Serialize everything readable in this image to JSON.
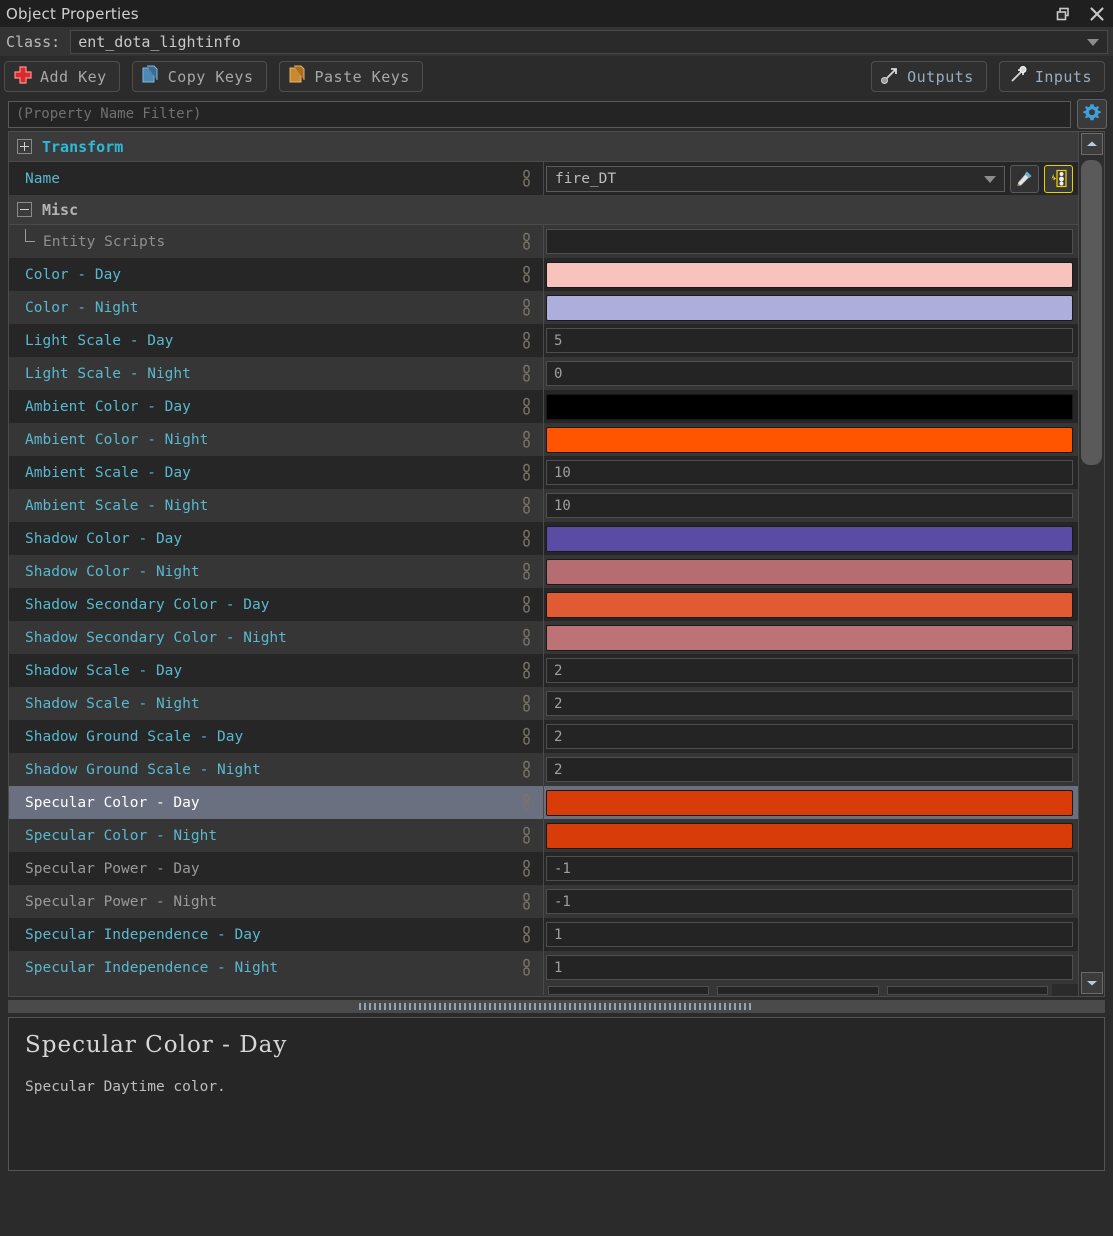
{
  "window": {
    "title": "Object Properties",
    "restore_icon": "restore-window-icon",
    "close_icon": "close-icon"
  },
  "class_row": {
    "label": "Class:",
    "value": "ent_dota_lightinfo",
    "dropdown_icon": "chevron-down-icon"
  },
  "toolbar": {
    "add_key": "Add Key",
    "copy_keys": "Copy Keys",
    "paste_keys": "Paste Keys",
    "outputs": "Outputs",
    "inputs": "Inputs"
  },
  "filter": {
    "placeholder": "(Property Name Filter)",
    "settings_icon": "gear-icon"
  },
  "categories": {
    "transform": "Transform",
    "misc": "Misc"
  },
  "name_row": {
    "label": "Name",
    "value": "fire_DT",
    "eyedropper_icon": "eyedropper-icon",
    "picker_icon": "entity-picker-icon"
  },
  "properties": [
    {
      "label": "Entity Scripts",
      "type": "text",
      "value": "",
      "style": "child"
    },
    {
      "label": "Color - Day",
      "type": "color",
      "value": "#f8c2bd"
    },
    {
      "label": "Color - Night",
      "type": "color",
      "value": "#aeaedd"
    },
    {
      "label": "Light Scale - Day",
      "type": "text",
      "value": "5"
    },
    {
      "label": "Light Scale - Night",
      "type": "text",
      "value": "0"
    },
    {
      "label": "Ambient Color - Day",
      "type": "color",
      "value": "#000000"
    },
    {
      "label": "Ambient Color - Night",
      "type": "color",
      "value": "#ff5500"
    },
    {
      "label": "Ambient Scale - Day",
      "type": "text",
      "value": "10"
    },
    {
      "label": "Ambient Scale - Night",
      "type": "text",
      "value": "10"
    },
    {
      "label": "Shadow Color - Day",
      "type": "color",
      "value": "#5a4ca5"
    },
    {
      "label": "Shadow Color - Night",
      "type": "color",
      "value": "#b56d71"
    },
    {
      "label": "Shadow Secondary Color - Day",
      "type": "color",
      "value": "#e05a34"
    },
    {
      "label": "Shadow Secondary Color - Night",
      "type": "color",
      "value": "#bd7376"
    },
    {
      "label": "Shadow Scale - Day",
      "type": "text",
      "value": "2"
    },
    {
      "label": "Shadow Scale - Night",
      "type": "text",
      "value": "2"
    },
    {
      "label": "Shadow Ground Scale - Day",
      "type": "text",
      "value": "2"
    },
    {
      "label": "Shadow Ground Scale - Night",
      "type": "text",
      "value": "2"
    },
    {
      "label": "Specular Color - Day",
      "type": "color",
      "value": "#d83c08",
      "selected": true
    },
    {
      "label": "Specular Color - Night",
      "type": "color",
      "value": "#d83c08"
    },
    {
      "label": "Specular Power - Day",
      "type": "text",
      "value": "-1",
      "style": "gray"
    },
    {
      "label": "Specular Power - Night",
      "type": "text",
      "value": "-1",
      "style": "gray"
    },
    {
      "label": "Specular Independence - Day",
      "type": "text",
      "value": "1"
    },
    {
      "label": "Specular Independence - Night",
      "type": "text",
      "value": "1"
    }
  ],
  "scrollbar": {
    "up_icon": "scroll-up-icon",
    "down_icon": "scroll-down-icon"
  },
  "description": {
    "title": "Specular Color - Day",
    "body": "Specular Daytime color."
  },
  "colors": {
    "accent_cyan": "#59b8cf",
    "category_cyan": "#2fb9d8",
    "selection": "#6b7080",
    "row_light": "#363636",
    "row_dark": "#262626",
    "panel_bg": "#2b2b2b"
  }
}
